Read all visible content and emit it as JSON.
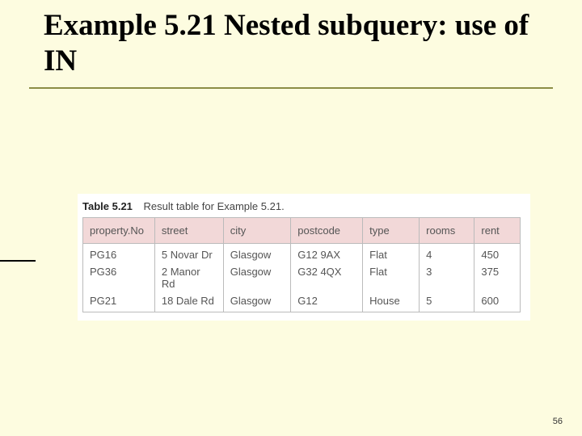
{
  "title": "Example 5.21  Nested subquery: use of IN",
  "pagenum": "56",
  "caption_label": "Table 5.21",
  "caption_text": "Result table for Example 5.21.",
  "columns": [
    "property.No",
    "street",
    "city",
    "postcode",
    "type",
    "rooms",
    "rent"
  ],
  "rows": [
    {
      "propertyNo": "PG16",
      "street": "5 Novar Dr",
      "city": "Glasgow",
      "postcode": "G12 9AX",
      "type": "Flat",
      "rooms": "4",
      "rent": "450"
    },
    {
      "propertyNo": "PG36",
      "street": "2 Manor Rd",
      "city": "Glasgow",
      "postcode": "G32 4QX",
      "type": "Flat",
      "rooms": "3",
      "rent": "375"
    },
    {
      "propertyNo": "PG21",
      "street": "18 Dale Rd",
      "city": "Glasgow",
      "postcode": "G12",
      "type": "House",
      "rooms": "5",
      "rent": "600"
    }
  ],
  "chart_data": {
    "type": "table",
    "title": "Result table for Example 5.21.",
    "columns": [
      "property.No",
      "street",
      "city",
      "postcode",
      "type",
      "rooms",
      "rent"
    ],
    "data": [
      [
        "PG16",
        "5 Novar Dr",
        "Glasgow",
        "G12 9AX",
        "Flat",
        4,
        450
      ],
      [
        "PG36",
        "2 Manor Rd",
        "Glasgow",
        "G32 4QX",
        "Flat",
        3,
        375
      ],
      [
        "PG21",
        "18 Dale Rd",
        "Glasgow",
        "G12",
        "House",
        5,
        600
      ]
    ]
  }
}
